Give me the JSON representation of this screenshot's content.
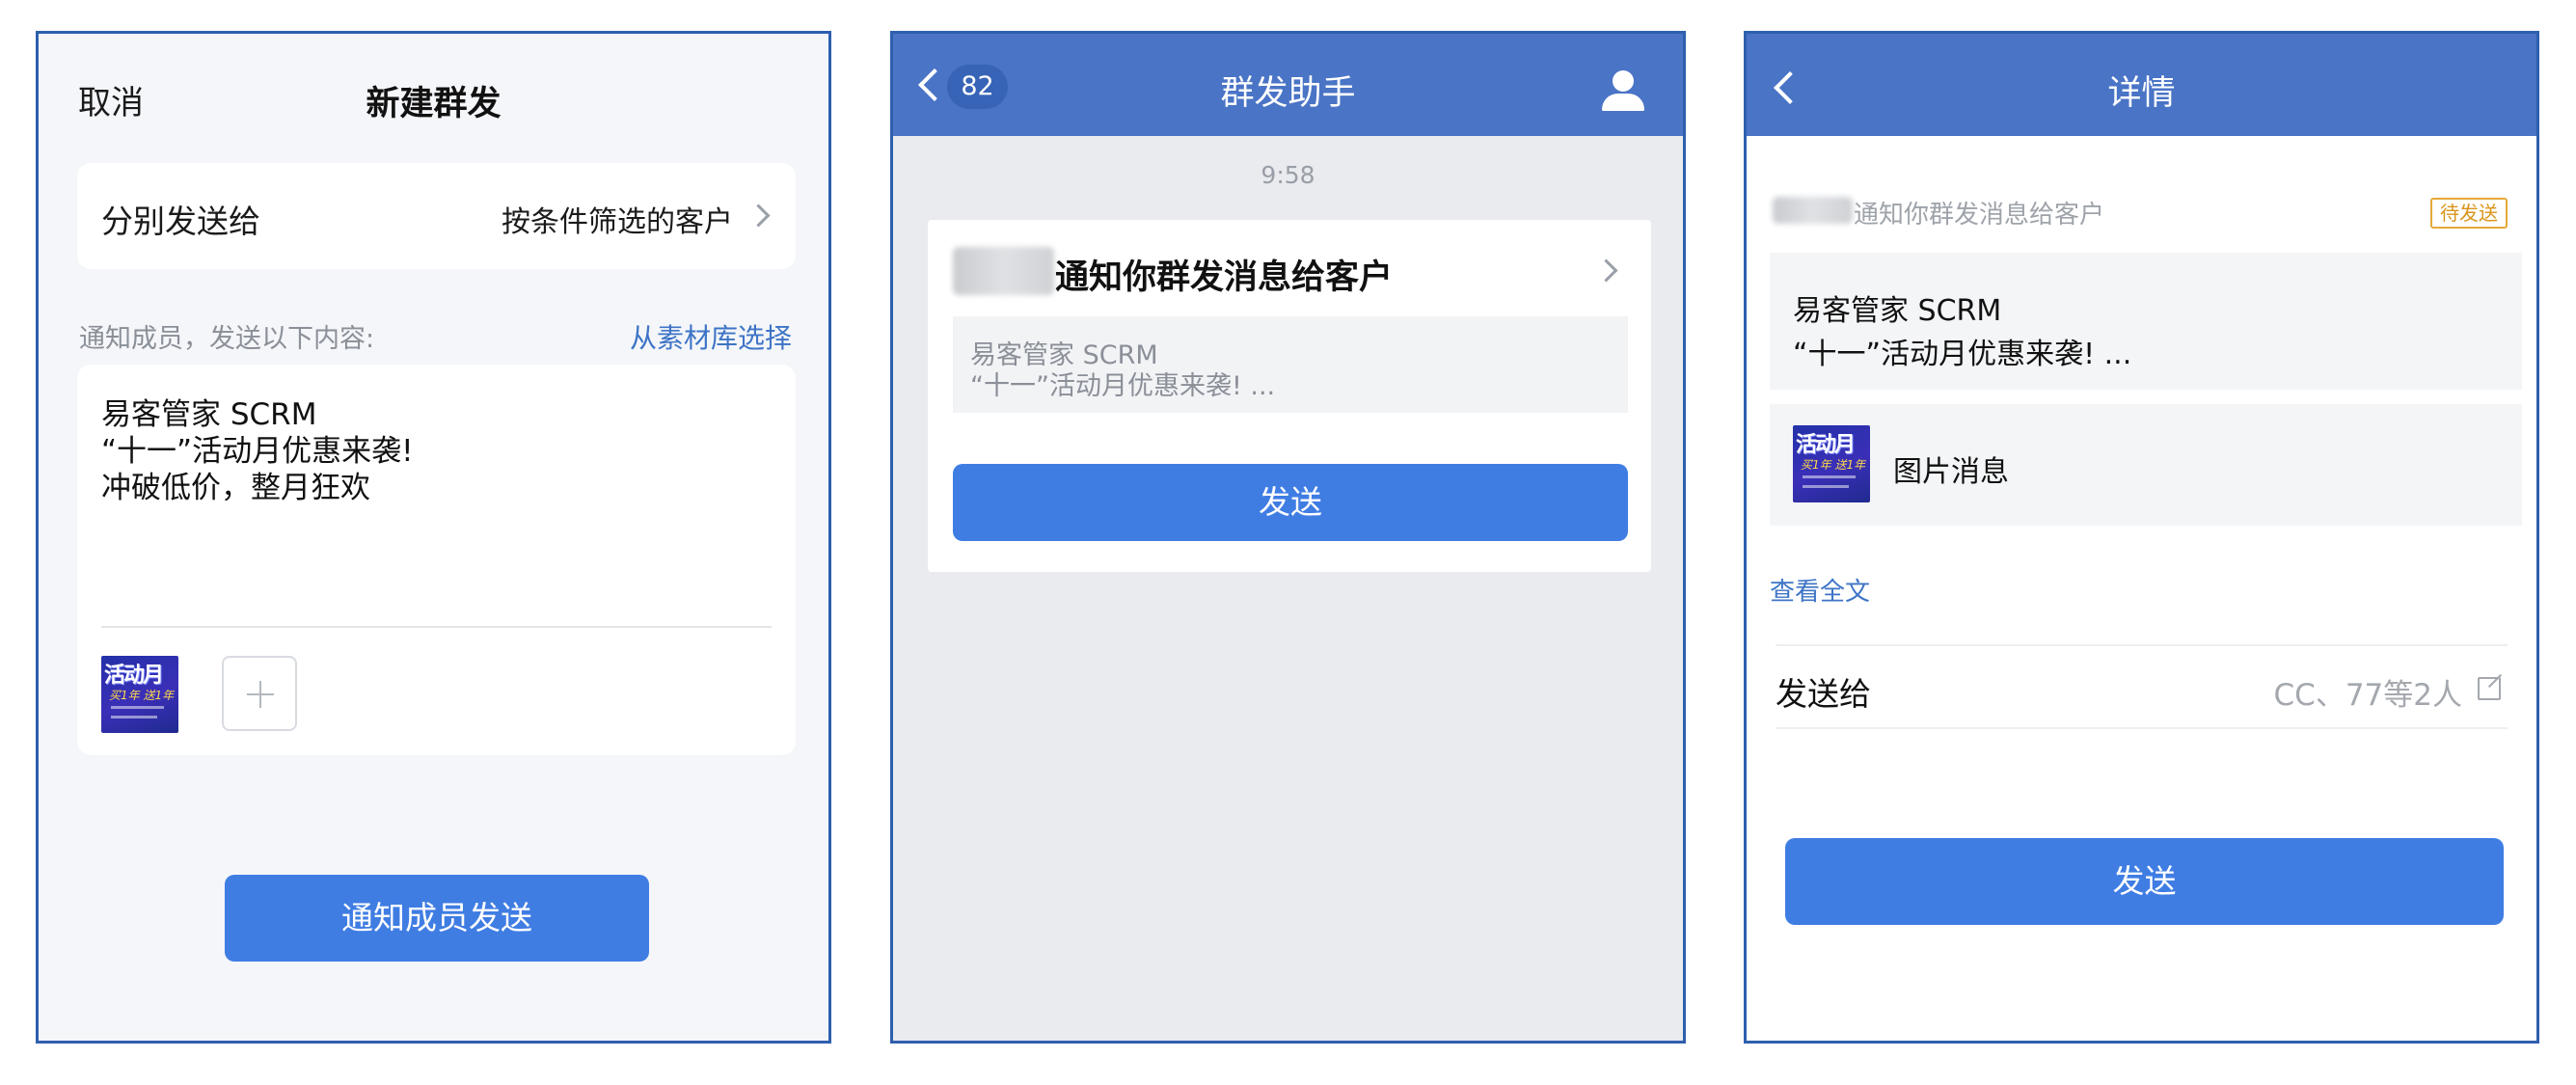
{
  "panel1": {
    "cancel_label": "取消",
    "title": "新建群发",
    "recipients_label": "分别发送给",
    "recipients_value": "按条件筛选的客户",
    "content_hint": "通知成员，发送以下内容:",
    "library_link": "从素材库选择",
    "message_lines": [
      "易客管家 SCRM",
      "“十一”活动月优惠来袭!",
      "冲破低价，整月狂欢"
    ],
    "thumbnail_text": "活动月",
    "thumbnail_subtext": "买1年 送1年",
    "notify_button": "通知成员发送"
  },
  "panel2": {
    "unread_count": "82",
    "title": "群发助手",
    "time": "9:58",
    "card_title": "通知你群发消息给客户",
    "preview_line1": "易客管家 SCRM",
    "preview_line2": "“十一”活动月优惠来袭! ...",
    "send_button": "发送"
  },
  "panel3": {
    "title": "详情",
    "notice_text": "通知你群发消息给客户",
    "status_badge": "待发送",
    "message_line1": "易客管家 SCRM",
    "message_line2": "“十一”活动月优惠来袭! ...",
    "image_message_label": "图片消息",
    "thumbnail_text": "活动月",
    "thumbnail_subtext": "买1年 送1年",
    "read_all_link": "查看全文",
    "send_to_label": "发送给",
    "recipients_value": "CC、77等2人",
    "send_button": "发送"
  },
  "colors": {
    "primary_button": "#3f7de3",
    "nav_bar": "#4a74c6",
    "link": "#3e74c6",
    "status_pending": "#e4a93a",
    "panel_border": "#2d5fae"
  },
  "icons": [
    "chevron-right-icon",
    "back-chevron-icon",
    "user-icon",
    "plus-icon",
    "edit-icon"
  ]
}
